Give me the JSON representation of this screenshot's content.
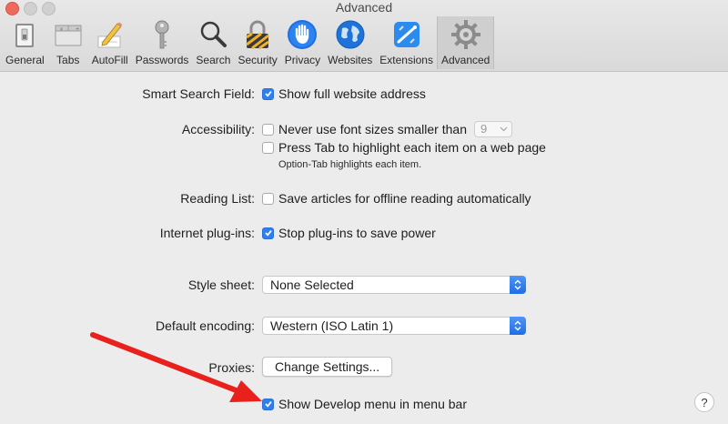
{
  "window": {
    "title": "Advanced"
  },
  "toolbar": {
    "items": [
      {
        "label": "General",
        "icon": "general-switch-icon"
      },
      {
        "label": "Tabs",
        "icon": "tabs-icon"
      },
      {
        "label": "AutoFill",
        "icon": "pencil-form-icon"
      },
      {
        "label": "Passwords",
        "icon": "key-icon"
      },
      {
        "label": "Search",
        "icon": "magnifier-icon"
      },
      {
        "label": "Security",
        "icon": "padlock-icon"
      },
      {
        "label": "Privacy",
        "icon": "hand-icon"
      },
      {
        "label": "Websites",
        "icon": "globe-icon"
      },
      {
        "label": "Extensions",
        "icon": "puzzle-icon"
      },
      {
        "label": "Advanced",
        "icon": "gear-icon",
        "selected": true
      }
    ]
  },
  "settings": {
    "smart_search": {
      "label": "Smart Search Field:",
      "option": "Show full website address",
      "checked": true
    },
    "accessibility": {
      "label": "Accessibility:",
      "font_option": "Never use font sizes smaller than",
      "font_checked": false,
      "font_size_value": "9",
      "tab_option": "Press Tab to highlight each item on a web page",
      "tab_checked": false,
      "tab_note": "Option-Tab highlights each item."
    },
    "reading_list": {
      "label": "Reading List:",
      "option": "Save articles for offline reading automatically",
      "checked": false
    },
    "plugins": {
      "label": "Internet plug-ins:",
      "option": "Stop plug-ins to save power",
      "checked": true
    },
    "style_sheet": {
      "label": "Style sheet:",
      "value": "None Selected"
    },
    "encoding": {
      "label": "Default encoding:",
      "value": "Western (ISO Latin 1)"
    },
    "proxies": {
      "label": "Proxies:",
      "button": "Change Settings..."
    },
    "develop": {
      "option": "Show Develop menu in menu bar",
      "checked": true
    }
  },
  "help": {
    "label": "?"
  },
  "colors": {
    "accent": "#2f7ff0",
    "annotation_arrow": "#e8211c"
  }
}
